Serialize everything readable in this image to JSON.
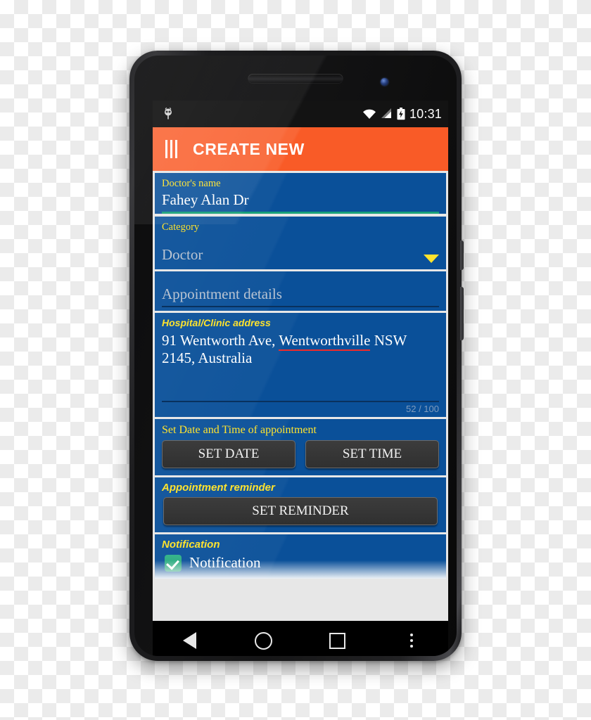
{
  "status_bar": {
    "notification_icon": "android-mascot-icon",
    "wifi_icon": "wifi-full-icon",
    "signal_icon": "cellular-signal-icon",
    "battery_icon": "battery-charging-icon",
    "clock": "10:31"
  },
  "toolbar": {
    "menu_icon": "three-vertical-bars-menu-icon",
    "title": "CREATE NEW",
    "background_color": "#f95b27"
  },
  "theme": {
    "card_blue": "#0a5099",
    "label_yellow": "#ffe32e",
    "accent_green": "#19a07a",
    "spellcheck_red": "#ef2b2b"
  },
  "form": {
    "doctor_name": {
      "label": "Doctor's name",
      "value": "Fahey Alan Dr",
      "placeholder": "Doctor's name"
    },
    "category": {
      "label": "Category",
      "value": "Doctor",
      "placeholder": "Doctor",
      "dropdown_icon": "caret-down-icon"
    },
    "appointment_details": {
      "placeholder": "Appointment details",
      "value": ""
    },
    "address": {
      "label": "Hospital/Clinic address",
      "line1_before": "91 Wentworth Ave, ",
      "line1_misspelled": "Wentworthville",
      "line1_after": " NSW",
      "line2": "2145, Australia",
      "counter": "52 / 100"
    },
    "date_time": {
      "label": "Set Date and Time of appointment",
      "set_date_label": "SET DATE",
      "set_time_label": "SET TIME"
    },
    "reminder": {
      "label": "Appointment reminder",
      "button_label": "SET REMINDER"
    },
    "notification": {
      "label": "Notification",
      "checkbox_label": "Notification",
      "checked": true
    }
  },
  "nav_bar": {
    "back_icon": "back-triangle-icon",
    "home_icon": "home-circle-icon",
    "recents_icon": "recents-square-icon",
    "overflow_icon": "overflow-dots-icon"
  }
}
